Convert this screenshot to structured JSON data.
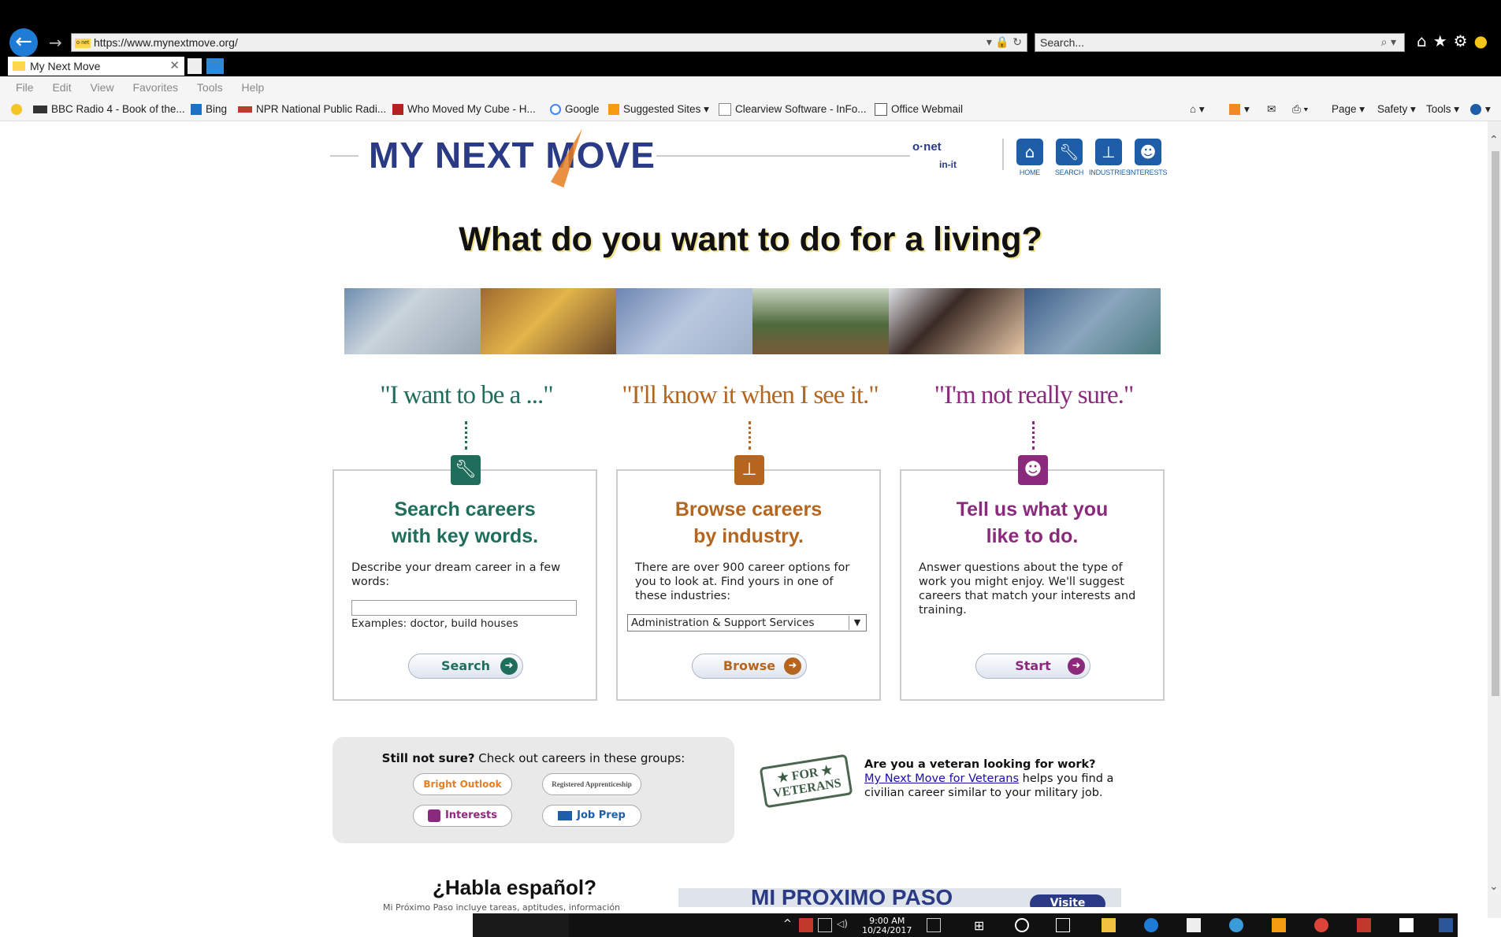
{
  "browser": {
    "url": "https://www.mynextmove.org/",
    "search_placeholder": "Search...",
    "tab_title": "My Next Move",
    "menu": [
      "File",
      "Edit",
      "View",
      "Favorites",
      "Tools",
      "Help"
    ],
    "favorites": [
      {
        "label": "BBC Radio 4 - Book of the...",
        "icon": "bbc-icon"
      },
      {
        "label": "Bing",
        "icon": "bing-icon"
      },
      {
        "label": "NPR  National Public Radi...",
        "icon": "npr-icon"
      },
      {
        "label": "Who Moved My Cube - H...",
        "icon": "hbr-icon"
      },
      {
        "label": "Google",
        "icon": "google-icon"
      },
      {
        "label": "Suggested Sites",
        "icon": "suggested-sites-icon"
      },
      {
        "label": "Clearview Software - InFo...",
        "icon": "page-icon"
      },
      {
        "label": "Office Webmail",
        "icon": "webmail-icon"
      }
    ],
    "command_bar": [
      "Page",
      "Safety",
      "Tools"
    ]
  },
  "header": {
    "logo": "MY NEXT MOVE",
    "onet_top": "o·net",
    "onet_bottom": "in-it",
    "nav": [
      "HOME",
      "SEARCH",
      "INDUSTRIES",
      "INTERESTS"
    ]
  },
  "headline": "What do you want to do for a living?",
  "columns": [
    {
      "quote": "\"I want to be a ...\"",
      "title": "Search careers\nwith key words.",
      "desc": "Describe your dream career in a few words:",
      "examples": "Examples: doctor, build houses",
      "button": "Search",
      "color": "#1f6e5c",
      "icon": "wrench-icon"
    },
    {
      "quote": "\"I'll know it when I see it.\"",
      "title": "Browse careers\nby industry.",
      "desc": "There are over 900 career options for you to look at. Find yours in one of these industries:",
      "select_value": "Administration & Support Services",
      "button": "Browse",
      "color": "#b5651d",
      "icon": "industry-icon"
    },
    {
      "quote": "\"I'm not really sure.\"",
      "title": "Tell us what you\nlike to do.",
      "desc": "Answer questions about the type of work you might enjoy. We'll suggest careers that match your interests and training.",
      "button": "Start",
      "color": "#8b2a7d",
      "icon": "person-icon"
    }
  ],
  "groups": {
    "lead": "Still not sure?",
    "text": " Check out careers in these groups:",
    "buttons": [
      "Bright Outlook",
      "Registered Apprenticeship",
      "Interests",
      "Job Prep"
    ]
  },
  "veterans": {
    "badge_top": "★ FOR ★",
    "badge_bottom": "VETERANS",
    "title": "Are you a veteran looking for work?",
    "link": "My Next Move for Veterans",
    "text": " helps you find a civilian career similar to your military job."
  },
  "spanish": {
    "title": "¿Habla español?",
    "sub": "Mi Próximo Paso incluye tareas, aptitudes, información",
    "banner": "MI PRÓXIMO PASO",
    "visite": "Visite"
  },
  "taskbar": {
    "time": "9:00 AM",
    "date": "10/24/2017"
  }
}
